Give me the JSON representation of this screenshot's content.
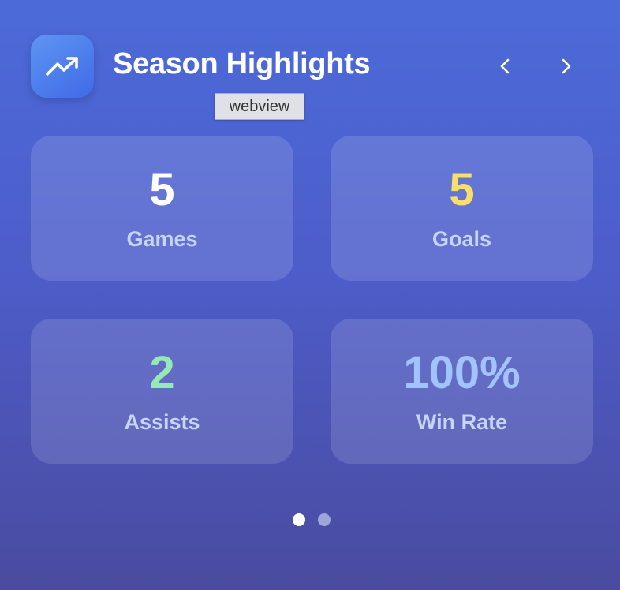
{
  "header": {
    "title": "Season Highlights",
    "icon": "trending-up-icon",
    "prev_icon": "chevron-left-icon",
    "next_icon": "chevron-right-icon"
  },
  "tooltip": {
    "text": "webview"
  },
  "stats": [
    {
      "value": "5",
      "label": "Games",
      "color": "#ffffff"
    },
    {
      "value": "5",
      "label": "Goals",
      "color": "#f8de6a"
    },
    {
      "value": "2",
      "label": "Assists",
      "color": "#96e9b4"
    },
    {
      "value": "100%",
      "label": "Win Rate",
      "color": "#a3c3ff"
    }
  ],
  "pagination": {
    "pages": 2,
    "active_index": 0,
    "active_color": "#ffffff",
    "inactive_color": "#9ea6d9"
  }
}
